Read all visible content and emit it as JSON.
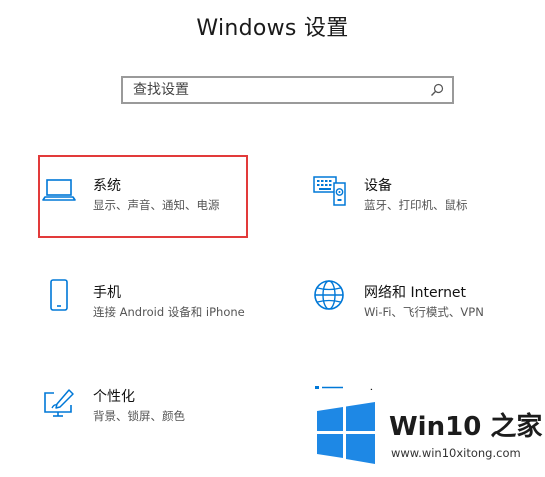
{
  "window": {
    "title": "Windows 设置"
  },
  "search": {
    "placeholder": "查找设置"
  },
  "tiles": [
    {
      "name": "系统",
      "desc": "显示、声音、通知、电源",
      "icon": "laptop-icon"
    },
    {
      "name": "设备",
      "desc": "蓝牙、打印机、鼠标",
      "icon": "keyboard-device-icon"
    },
    {
      "name": "手机",
      "desc": "连接 Android 设备和 iPhone",
      "icon": "phone-icon"
    },
    {
      "name": "网络和 Internet",
      "desc": "Wi-Fi、飞行模式、VPN",
      "icon": "globe-icon"
    },
    {
      "name": "个性化",
      "desc": "背景、锁屏、颜色",
      "icon": "personalization-icon"
    },
    {
      "name": "应用",
      "desc": "",
      "icon": "apps-list-icon"
    }
  ],
  "watermark": {
    "title": "Win10 之家",
    "url": "www.win10xitong.com"
  },
  "colors": {
    "accent": "#0078d7",
    "highlight": "#e23a3a",
    "logo_blue": "#1e88e5"
  }
}
